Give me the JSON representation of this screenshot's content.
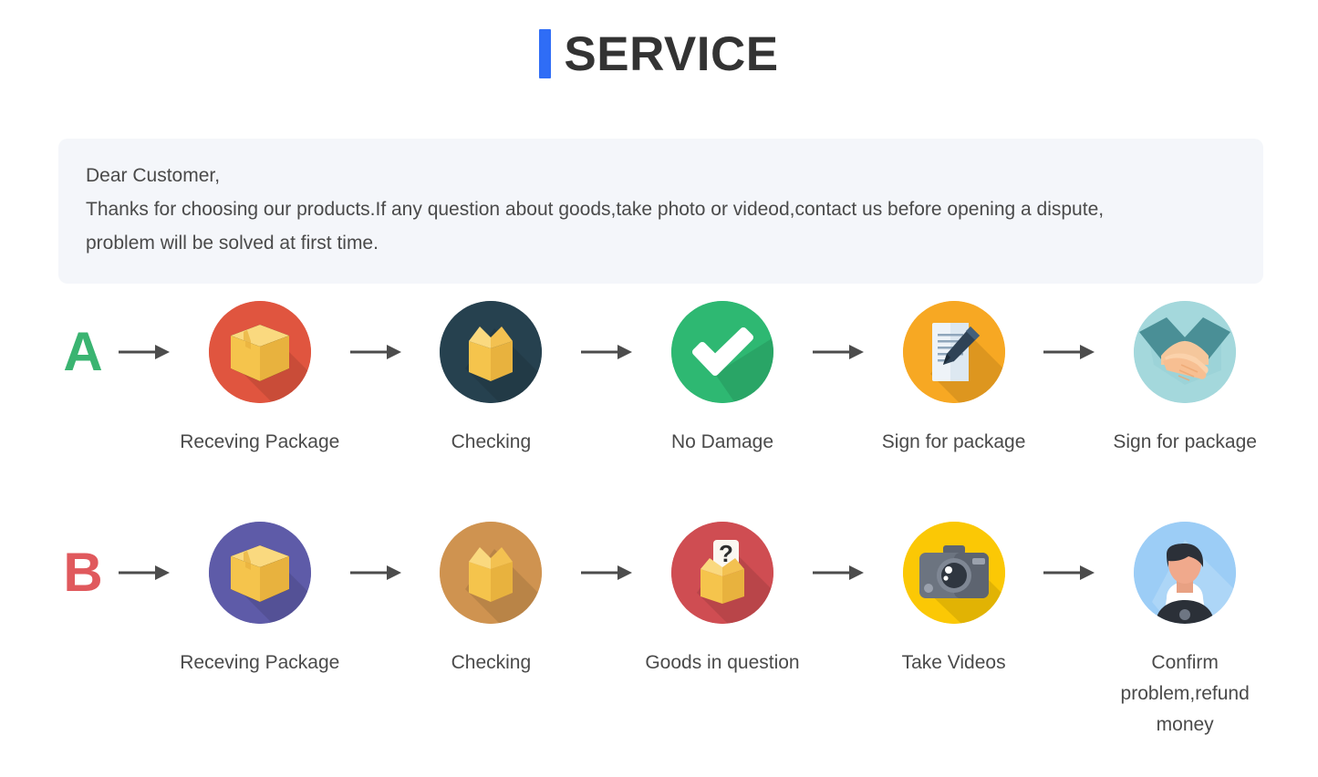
{
  "header": {
    "accent_color": "#2f6df6",
    "title": "SERVICE"
  },
  "notice": {
    "background_color": "#f4f6fa",
    "line1": "Dear Customer,",
    "line2": "Thanks for choosing our products.If any question about goods,take photo or videod,contact us before opening a dispute,",
    "line3": "problem will be solved at first time."
  },
  "flows": [
    {
      "key": "flow-a",
      "letter": "A",
      "letter_color": "#3ab471",
      "steps": [
        {
          "label": "Receving Package",
          "icon": "closed-box-icon",
          "circle_color": "#e0553f"
        },
        {
          "label": "Checking",
          "icon": "open-box-icon",
          "circle_color": "#26414f"
        },
        {
          "label": "No Damage",
          "icon": "check-mark-icon",
          "circle_color": "#2eb872"
        },
        {
          "label": "Sign for package",
          "icon": "document-pen-icon",
          "circle_color": "#f7a823"
        },
        {
          "label": "Sign for package",
          "icon": "handshake-icon",
          "circle_color": "#a4d8dc"
        }
      ]
    },
    {
      "key": "flow-b",
      "letter": "B",
      "letter_color": "#e0595d",
      "steps": [
        {
          "label": "Receving Package",
          "icon": "closed-box-icon",
          "circle_color": "#5e5ba8"
        },
        {
          "label": "Checking",
          "icon": "open-box-icon",
          "circle_color": "#cf9350"
        },
        {
          "label": "Goods in question",
          "icon": "question-box-icon",
          "circle_color": "#cf4d52"
        },
        {
          "label": "Take Videos",
          "icon": "camera-icon",
          "circle_color": "#fbc805"
        },
        {
          "label": "Confirm problem,refund money",
          "icon": "person-icon",
          "circle_color": "#9ccdf6"
        }
      ]
    }
  ],
  "arrow": {
    "name": "arrow-right-icon",
    "color": "#3d3d3d"
  }
}
